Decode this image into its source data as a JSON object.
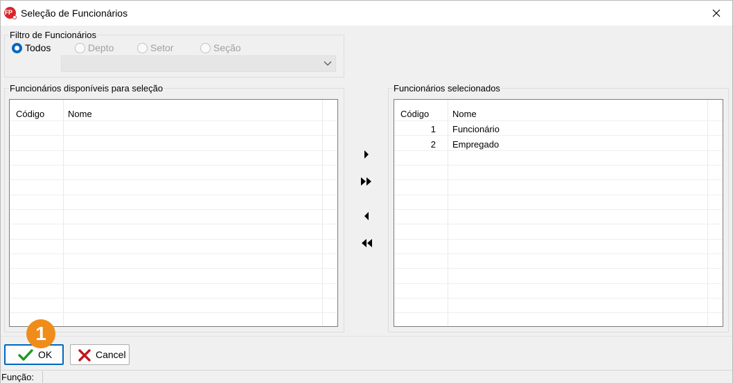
{
  "window": {
    "title": "Seleção de Funcionários",
    "app_icon_text": "FP"
  },
  "filter": {
    "group_label": "Filtro de Funcionários",
    "options": [
      {
        "label": "Todos",
        "checked": true
      },
      {
        "label": "Depto",
        "checked": false
      },
      {
        "label": "Setor",
        "checked": false
      },
      {
        "label": "Seção",
        "checked": false
      }
    ],
    "combo_value": ""
  },
  "available": {
    "group_label": "Funcionários disponíveis para seleção",
    "columns": [
      "Código",
      "Nome"
    ],
    "rows": []
  },
  "selected": {
    "group_label": "Funcionários selecionados",
    "columns": [
      "Código",
      "Nome"
    ],
    "rows": [
      {
        "code": "1",
        "name": "Funcionário"
      },
      {
        "code": "2",
        "name": "Empregado"
      }
    ]
  },
  "buttons": {
    "ok": "OK",
    "cancel": "Cancel"
  },
  "badge": "1",
  "status": {
    "label": "Função:"
  }
}
